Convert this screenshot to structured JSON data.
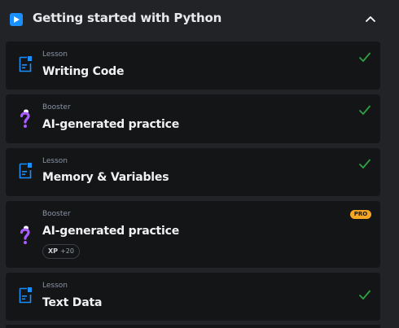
{
  "section": {
    "title": "Getting started with Python"
  },
  "items": [
    {
      "type": "Lesson",
      "title": "Writing Code",
      "completed": true,
      "icon": "document-icon"
    },
    {
      "type": "Booster",
      "title": "AI-generated practice",
      "completed": true,
      "icon": "question-mark-icon"
    },
    {
      "type": "Lesson",
      "title": "Memory & Variables",
      "completed": true,
      "icon": "document-icon"
    },
    {
      "type": "Booster",
      "title": "AI-generated practice",
      "completed": false,
      "icon": "question-mark-icon",
      "badge": "PRO",
      "xp_label": "XP",
      "xp_value": "+20"
    },
    {
      "type": "Lesson",
      "title": "Text Data",
      "completed": true,
      "icon": "document-icon"
    }
  ],
  "colors": {
    "background": "#222326",
    "card": "#141517",
    "accent_blue": "#1a8fff",
    "check_green": "#2ea043",
    "pro_badge": "#f5a623",
    "booster_purple": "#a95cff"
  }
}
